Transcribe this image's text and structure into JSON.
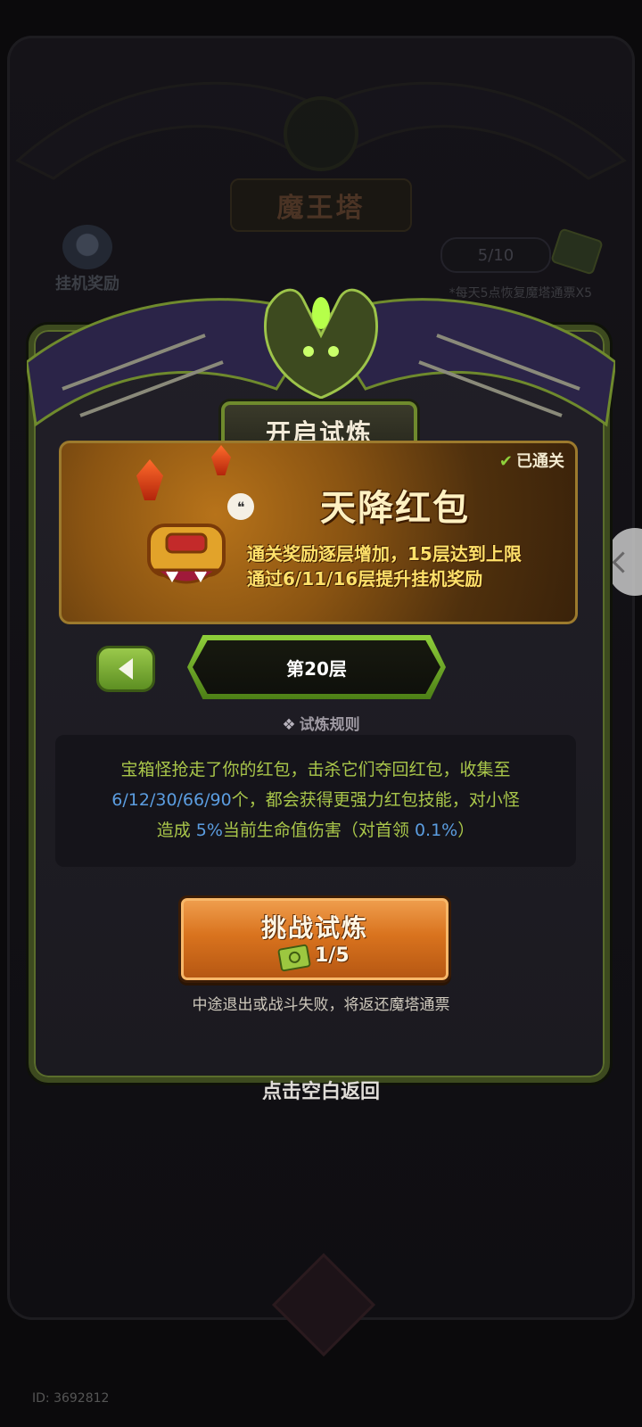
{
  "background": {
    "tower_title": "魔王塔",
    "idle_reward_label": "挂机奖励",
    "ticket_counter": "5/10",
    "daily_note": "*每天5点恢复魔塔通票X5",
    "id_label": "ID: 3692812"
  },
  "modal": {
    "header_title": "开启试炼",
    "event": {
      "status": "已通关",
      "title": "天降红包",
      "desc_line1": "通关奖励逐层增加，15层达到上限",
      "desc_line2": "通过6/11/16层提升挂机奖励"
    },
    "floor_label": "第20层",
    "rules_link": "试炼规则",
    "rules": {
      "line1": "宝箱怪抢走了你的红包，击杀它们夺回红包，收集至",
      "line2_numbers": "6/12/30/66/90",
      "line2_rest": "个，都会获得更强力红包技能，对小怪",
      "line3_prefix": "造成 ",
      "line3_pct": "5%",
      "line3_mid": "当前生命值伤害（对首领 ",
      "line3_boss_pct": "0.1%",
      "line3_suffix": "）"
    },
    "challenge_button": {
      "label": "挑战试炼",
      "cost": "1/5"
    },
    "refund_note": "中途退出或战斗失败，将返还魔塔通票"
  },
  "tap_return": "点击空白返回",
  "colors": {
    "accent_green": "#8fcf3a",
    "button_orange": "#d9731e",
    "rules_green": "#a9c64a",
    "rules_blue": "#5b9de0",
    "event_yellow": "#ffe16a"
  }
}
